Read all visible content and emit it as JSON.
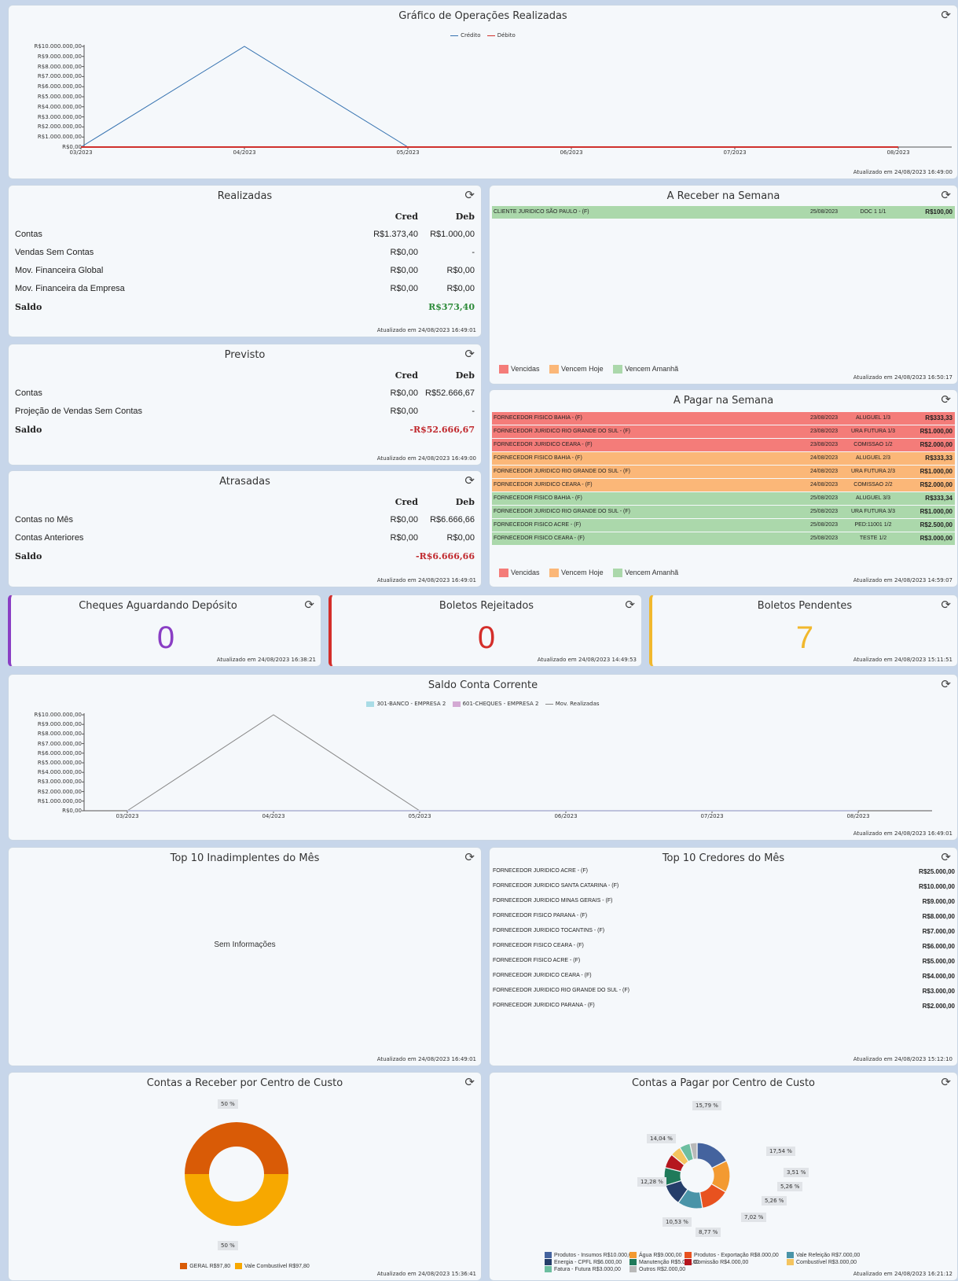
{
  "refresh_icon": "refresh-icon",
  "ops": {
    "title": "Gráfico de Operações Realizadas",
    "legend": [
      "Crédito",
      "Débito"
    ],
    "colors": [
      "#3572b0",
      "#d0312d"
    ],
    "yticks": [
      "R$10.000.000,00",
      "R$9.000.000,00",
      "R$8.000.000,00",
      "R$7.000.000,00",
      "R$6.000.000,00",
      "R$5.000.000,00",
      "R$4.000.000,00",
      "R$3.000.000,00",
      "R$2.000.000,00",
      "R$1.000.000,00",
      "R$0,00"
    ],
    "updated": "Atualizado em 24/08/2023 16:49:00"
  },
  "realizadas": {
    "title": "Realizadas",
    "cred": "Cred",
    "deb": "Deb",
    "rows": [
      {
        "label": "Contas",
        "cred": "R$1.373,40",
        "deb": "R$1.000,00"
      },
      {
        "label": "Vendas Sem Contas",
        "cred": "R$0,00",
        "deb": "-"
      },
      {
        "label": "Mov. Financeira Global",
        "cred": "R$0,00",
        "deb": "R$0,00"
      },
      {
        "label": "Mov. Financeira da Empresa",
        "cred": "R$0,00",
        "deb": "R$0,00"
      }
    ],
    "saldo_label": "Saldo",
    "saldo": "R$373,40",
    "updated": "Atualizado em 24/08/2023 16:49:01"
  },
  "previsto": {
    "title": "Previsto",
    "cred": "Cred",
    "deb": "Deb",
    "rows": [
      {
        "label": "Contas",
        "cred": "R$0,00",
        "deb": "R$52.666,67"
      },
      {
        "label": "Projeção de Vendas Sem Contas",
        "cred": "R$0,00",
        "deb": "-"
      }
    ],
    "saldo_label": "Saldo",
    "saldo": "-R$52.666,67",
    "updated": "Atualizado em 24/08/2023 16:49:00"
  },
  "atrasadas": {
    "title": "Atrasadas",
    "cred": "Cred",
    "deb": "Deb",
    "rows": [
      {
        "label": "Contas no Mês",
        "cred": "R$0,00",
        "deb": "R$6.666,66"
      },
      {
        "label": "Contas Anteriores",
        "cred": "R$0,00",
        "deb": "R$0,00"
      }
    ],
    "saldo_label": "Saldo",
    "saldo": "-R$6.666,66",
    "updated": "Atualizado em 24/08/2023 16:49:01"
  },
  "receber": {
    "title": "A Receber na Semana",
    "rows": [
      {
        "name": "CLIENTE JURIDICO SÃO PAULO - (F)",
        "date": "25/08/2023",
        "doc": "DOC 1 1/1",
        "value": "R$100,00",
        "status": "grn"
      }
    ],
    "legend": [
      "Vencidas",
      "Vencem Hoje",
      "Vencem Amanhã"
    ],
    "updated": "Atualizado em 24/08/2023 16:50:17"
  },
  "pagar": {
    "title": "A Pagar na Semana",
    "rows": [
      {
        "name": "FORNECEDOR FISICO BAHIA - (F)",
        "date": "23/08/2023",
        "doc": "ALUGUEL 1/3",
        "value": "R$333,33",
        "status": "red"
      },
      {
        "name": "FORNECEDOR JURIDICO RIO GRANDE DO SUL - (F)",
        "date": "23/08/2023",
        "doc": "URA FUTURA 1/3",
        "value": "R$1.000,00",
        "status": "red"
      },
      {
        "name": "FORNECEDOR JURIDICO CEARA - (F)",
        "date": "23/08/2023",
        "doc": "COMISSAO 1/2",
        "value": "R$2.000,00",
        "status": "red"
      },
      {
        "name": "FORNECEDOR FISICO BAHIA - (F)",
        "date": "24/08/2023",
        "doc": "ALUGUEL 2/3",
        "value": "R$333,33",
        "status": "org"
      },
      {
        "name": "FORNECEDOR JURIDICO RIO GRANDE DO SUL - (F)",
        "date": "24/08/2023",
        "doc": "URA FUTURA 2/3",
        "value": "R$1.000,00",
        "status": "org"
      },
      {
        "name": "FORNECEDOR JURIDICO CEARA - (F)",
        "date": "24/08/2023",
        "doc": "COMISSAO 2/2",
        "value": "R$2.000,00",
        "status": "org"
      },
      {
        "name": "FORNECEDOR FISICO BAHIA - (F)",
        "date": "25/08/2023",
        "doc": "ALUGUEL 3/3",
        "value": "R$333,34",
        "status": "grn"
      },
      {
        "name": "FORNECEDOR JURIDICO RIO GRANDE DO SUL - (F)",
        "date": "25/08/2023",
        "doc": "URA FUTURA 3/3",
        "value": "R$1.000,00",
        "status": "grn"
      },
      {
        "name": "FORNECEDOR FISICO ACRE - (F)",
        "date": "25/08/2023",
        "doc": "PED:11001 1/2",
        "value": "R$2.500,00",
        "status": "grn"
      },
      {
        "name": "FORNECEDOR FISICO CEARA - (F)",
        "date": "25/08/2023",
        "doc": "TESTE 1/2",
        "value": "R$3.000,00",
        "status": "grn"
      }
    ],
    "legend": [
      "Vencidas",
      "Vencem Hoje",
      "Vencem Amanhã"
    ],
    "updated": "Atualizado em 24/08/2023 14:59:07"
  },
  "status_colors": {
    "red": "#f47c79",
    "org": "#fbb778",
    "grn": "#abd8ab"
  },
  "kpis": [
    {
      "title": "Cheques Aguardando Depósito",
      "value": "0",
      "color": "#8a3ec4",
      "updated": "Atualizado em 24/08/2023 16:38:21"
    },
    {
      "title": "Boletos Rejeitados",
      "value": "0",
      "color": "#d42e2a",
      "updated": "Atualizado em 24/08/2023 14:49:53"
    },
    {
      "title": "Boletos Pendentes",
      "value": "7",
      "color": "#f1b82d",
      "updated": "Atualizado em 24/08/2023 15:11:51"
    }
  ],
  "saldo": {
    "title": "Saldo Conta Corrente",
    "legend": [
      "301-BANCO - EMPRESA 2",
      "601-CHEQUES - EMPRESA 2",
      "Mov. Realizadas"
    ],
    "legend_colors": [
      "#a9dce6",
      "#d3a9d3",
      "#888888"
    ],
    "yticks": [
      "R$10.000.000,00",
      "R$9.000.000,00",
      "R$8.000.000,00",
      "R$7.000.000,00",
      "R$6.000.000,00",
      "R$5.000.000,00",
      "R$4.000.000,00",
      "R$3.000.000,00",
      "R$2.000.000,00",
      "R$1.000.000,00",
      "R$0,00"
    ],
    "updated": "Atualizado em 24/08/2023 16:49:01"
  },
  "inadimplentes": {
    "title": "Top 10 Inadimplentes do Mês",
    "empty": "Sem Informações",
    "updated": "Atualizado em 24/08/2023 16:49:01"
  },
  "credores": {
    "title": "Top 10 Credores do Mês",
    "rows": [
      {
        "name": "FORNECEDOR JURIDICO ACRE - (F)",
        "value": "R$25.000,00"
      },
      {
        "name": "FORNECEDOR JURIDICO SANTA CATARINA - (F)",
        "value": "R$10.000,00"
      },
      {
        "name": "FORNECEDOR JURIDICO MINAS GERAIS - (F)",
        "value": "R$9.000,00"
      },
      {
        "name": "FORNECEDOR FISICO PARANA - (F)",
        "value": "R$8.000,00"
      },
      {
        "name": "FORNECEDOR JURIDICO TOCANTINS - (F)",
        "value": "R$7.000,00"
      },
      {
        "name": "FORNECEDOR FISICO CEARA - (F)",
        "value": "R$6.000,00"
      },
      {
        "name": "FORNECEDOR FISICO ACRE - (F)",
        "value": "R$5.000,00"
      },
      {
        "name": "FORNECEDOR JURIDICO CEARA - (F)",
        "value": "R$4.000,00"
      },
      {
        "name": "FORNECEDOR JURIDICO RIO GRANDE DO SUL - (F)",
        "value": "R$3.000,00"
      },
      {
        "name": "FORNECEDOR JURIDICO PARANA - (F)",
        "value": "R$2.000,00"
      }
    ],
    "updated": "Atualizado em 24/08/2023 15:12:10"
  },
  "ccr": {
    "title": "Contas a Receber por Centro de Custo",
    "labels": [
      "50 %",
      "50 %"
    ],
    "legend": [
      {
        "name": "GERAL",
        "value": "R$97,80",
        "color": "#d95b06"
      },
      {
        "name": "Vale Combustível",
        "value": "R$97,80",
        "color": "#f7a800"
      }
    ],
    "updated": "Atualizado em 24/08/2023 15:36:41"
  },
  "ccp": {
    "title": "Contas a Pagar por Centro de Custo",
    "legend": [
      {
        "name": "Produtos - Insumos",
        "value": "R$10.000,00",
        "color": "#44639e"
      },
      {
        "name": "Água",
        "value": "R$9.000,00",
        "color": "#f39a31"
      },
      {
        "name": "Produtos - Exportação",
        "value": "R$8.000,00",
        "color": "#e8521f"
      },
      {
        "name": "Vale Refeição",
        "value": "R$7.000,00",
        "color": "#4a94a8"
      },
      {
        "name": "Energia - CPFL",
        "value": "R$6.000,00",
        "color": "#253e6a"
      },
      {
        "name": "Manutenção",
        "value": "R$5.000,00",
        "color": "#1f7a5a"
      },
      {
        "name": "Comissão",
        "value": "R$4.000,00",
        "color": "#b5161e"
      },
      {
        "name": "Combustível",
        "value": "R$3.000,00",
        "color": "#f4c45f"
      },
      {
        "name": "Fatura - Futura",
        "value": "R$3.000,00",
        "color": "#6cbea0"
      },
      {
        "name": "Outros",
        "value": "R$2.000,00",
        "color": "#b9b9b9"
      }
    ],
    "updated": "Atualizado em 24/08/2023 16:21:12"
  },
  "chart_data": [
    {
      "type": "line",
      "title": "Gráfico de Operações Realizadas",
      "x": [
        "03/2023",
        "04/2023",
        "05/2023",
        "06/2023",
        "07/2023",
        "08/2023"
      ],
      "ylim": [
        0,
        10000000
      ],
      "series": [
        {
          "name": "Crédito",
          "values": [
            0,
            10000000,
            0,
            0,
            0,
            0
          ]
        },
        {
          "name": "Débito",
          "values": [
            0,
            0,
            0,
            0,
            0,
            0
          ]
        }
      ]
    },
    {
      "type": "line",
      "title": "Saldo Conta Corrente",
      "x": [
        "03/2023",
        "04/2023",
        "05/2023",
        "06/2023",
        "07/2023",
        "08/2023"
      ],
      "ylim": [
        0,
        10000000
      ],
      "series": [
        {
          "name": "Mov. Realizadas",
          "values": [
            0,
            10000000,
            0,
            0,
            0,
            0
          ]
        },
        {
          "name": "301-BANCO - EMPRESA 2",
          "values": [
            0,
            0,
            0,
            0,
            0,
            0
          ]
        },
        {
          "name": "601-CHEQUES - EMPRESA 2",
          "values": [
            0,
            0,
            0,
            0,
            0,
            0
          ]
        }
      ]
    },
    {
      "type": "pie",
      "title": "Contas a Receber por Centro de Custo",
      "labels": [
        "GERAL",
        "Vale Combustível"
      ],
      "values": [
        97.8,
        97.8
      ]
    },
    {
      "type": "pie",
      "title": "Contas a Pagar por Centro de Custo",
      "labels": [
        "Produtos - Insumos",
        "Água",
        "Produtos - Exportação",
        "Vale Refeição",
        "Energia - CPFL",
        "Manutenção",
        "Comissão",
        "Combustível",
        "Fatura - Futura",
        "Outros"
      ],
      "values": [
        10000,
        9000,
        8000,
        7000,
        6000,
        5000,
        4000,
        3000,
        3000,
        2000
      ],
      "percent_labels": [
        "17,54 %",
        "15,79 %",
        "14,04 %",
        "12,28 %",
        "10,53 %",
        "8,77 %",
        "7,02 %",
        "5,26 %",
        "5,26 %",
        "3,51 %"
      ]
    }
  ]
}
